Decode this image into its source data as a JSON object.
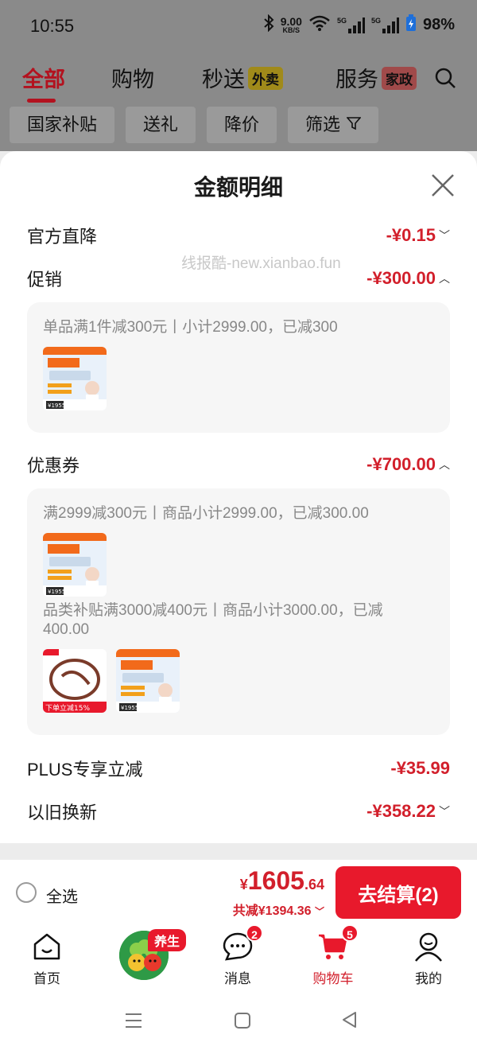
{
  "status": {
    "time": "10:55",
    "net_speed_value": "9.00",
    "net_speed_unit": "KB/S",
    "sig1": "5G",
    "sig2": "5G",
    "battery": "98%"
  },
  "topnav": {
    "tabs": [
      {
        "label": "全部"
      },
      {
        "label": "购物"
      },
      {
        "label": "秒送",
        "badge": "外卖"
      },
      {
        "label": "服务",
        "badge": "家政"
      }
    ],
    "filters": [
      "国家补贴",
      "送礼",
      "降价",
      "筛选"
    ]
  },
  "sheet": {
    "title": "金额明细",
    "watermark": "线报酷-new.xianbao.fun",
    "rows": {
      "official": {
        "label": "官方直降",
        "amount": "-¥0.15"
      },
      "promo": {
        "label": "促销",
        "amount": "-¥300.00"
      },
      "coupon": {
        "label": "优惠券",
        "amount": "-¥700.00"
      },
      "plus": {
        "label": "PLUS专享立减",
        "amount": "-¥35.99"
      },
      "tradein": {
        "label": "以旧换新",
        "amount": "-¥358.22"
      }
    },
    "promo_detail": "单品满1件减300元丨小计2999.00，已减300",
    "coupon_detail1": "满2999减300元丨商品小计2999.00，已减300.00",
    "coupon_detail2": "品类补贴满3000减400元丨商品小计3000.00，已减400.00",
    "thumb": {
      "series": "11.11送系列",
      "price": "¥1955",
      "cable_tag": "下单立减15%"
    }
  },
  "cart": {
    "select_all": "全选",
    "total_symbol": "¥",
    "total_int": "1605",
    "total_dec": ".64",
    "saved": "共减¥1394.36",
    "checkout": "去结算(2)"
  },
  "bottomnav": {
    "home": "首页",
    "promo_tag": "养生",
    "messages": "消息",
    "messages_badge": "2",
    "cart": "购物车",
    "cart_badge": "5",
    "mine": "我的"
  },
  "colors": {
    "accent": "#e8192c",
    "price_red": "#d21f2b",
    "dim_overlay": "#8a8a8a"
  }
}
